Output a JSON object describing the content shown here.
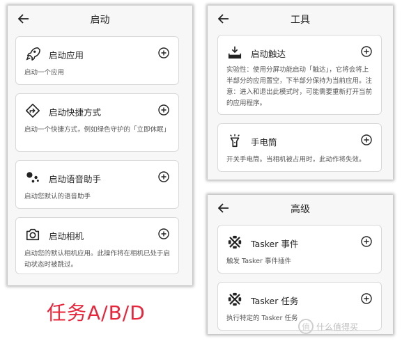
{
  "left_panel": {
    "title": "启动",
    "cards": [
      {
        "icon": "rocket-icon",
        "title": "启动应用",
        "desc": "启动一个应用"
      },
      {
        "icon": "shortcut-diamond-icon",
        "title": "启动快捷方式",
        "desc": "启动一个快捷方式，例如绿色守护的「立即休眠」"
      },
      {
        "icon": "assistant-dots-icon",
        "title": "启动语音助手",
        "desc": "启动您默认的语音助手"
      },
      {
        "icon": "camera-icon",
        "title": "启动相机",
        "desc": "启动您的默认相机应用。此操作将在相机已处于启动状态时被跳过。"
      }
    ]
  },
  "tools_panel": {
    "title": "工具",
    "cards": [
      {
        "icon": "reach-tray-icon",
        "title": "启动触达",
        "desc": "实验性：使用分屏功能启动「触达」，它将会将上半部分的应用置空，下半部分保持为当前应用。注意：进入和退出此模式时，可能需要重新打开当前的应用程序。"
      },
      {
        "icon": "flashlight-icon",
        "title": "手电筒",
        "desc": "开关手电筒。当相机被占用时，此动作将失效。"
      }
    ]
  },
  "advanced_panel": {
    "title": "高级",
    "cards": [
      {
        "icon": "tasker-icon",
        "title": "Tasker 事件",
        "desc": "触发 Tasker 事件插件"
      },
      {
        "icon": "tasker-icon",
        "title": "Tasker 任务",
        "desc": "执行特定的 Tasker 任务"
      }
    ]
  },
  "caption": "任务A/B/D",
  "watermark": {
    "logo": "值",
    "text": "什么值得买"
  },
  "colors": {
    "caption": "#e8253a",
    "panel_bg": "#f7f7f7",
    "card_border": "#d9d9d9"
  }
}
